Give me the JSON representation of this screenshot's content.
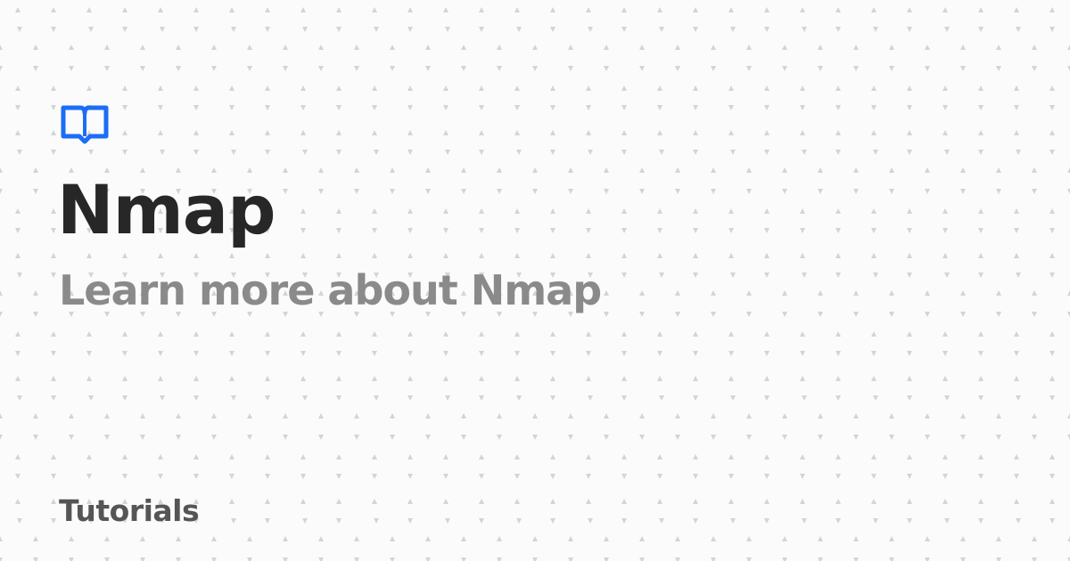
{
  "colors": {
    "background": "#fbfbfb",
    "pattern_dot": "#d4d4d4",
    "accent": "#1a6ef5",
    "title": "#272727",
    "subtitle": "#8a8a8a",
    "category": "#555555"
  },
  "logo": {
    "icon": "open-book-icon"
  },
  "card": {
    "title": "Nmap",
    "subtitle": "Learn more about Nmap",
    "category": "Tutorials"
  }
}
